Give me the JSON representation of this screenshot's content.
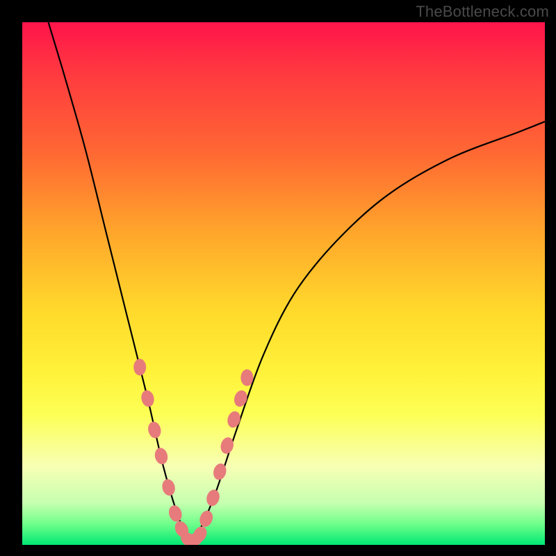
{
  "watermark": "TheBottleneck.com",
  "colors": {
    "frame": "#000000",
    "curve": "#000000",
    "beads": "#e77b7b",
    "gradient_top": "#ff144b",
    "gradient_bottom": "#00e874"
  },
  "chart_data": {
    "type": "line",
    "title": "",
    "xlabel": "",
    "ylabel": "",
    "xlim": [
      0,
      100
    ],
    "ylim": [
      0,
      100
    ],
    "note": "No axes/ticks shown; values are percentage of plot area, y measured from bottom. Curve depicts bottleneck deviation vs hardware balance; minimum near x≈32.",
    "series": [
      {
        "name": "bottleneck-curve",
        "x": [
          5,
          8,
          12,
          16,
          20,
          24,
          27,
          30,
          32,
          34,
          37,
          41,
          46,
          52,
          60,
          70,
          82,
          95,
          100
        ],
        "y": [
          100,
          90,
          76,
          60,
          44,
          28,
          15,
          5,
          1,
          3,
          10,
          22,
          36,
          48,
          58,
          67,
          74,
          79,
          81
        ]
      }
    ],
    "markers": {
      "name": "highlight-beads",
      "x": [
        22.5,
        24.0,
        25.3,
        26.6,
        28.0,
        29.3,
        30.5,
        31.8,
        33.0,
        34.0,
        35.2,
        36.5,
        37.8,
        39.2,
        40.5,
        41.8,
        43.0
      ],
      "y": [
        34,
        28,
        22,
        17,
        11,
        6,
        3,
        1,
        1,
        2,
        5,
        9,
        14,
        19,
        24,
        28,
        32
      ]
    }
  }
}
